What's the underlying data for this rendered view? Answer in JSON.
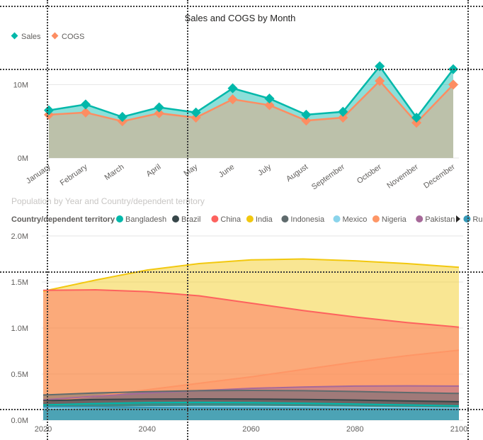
{
  "chart_data": [
    {
      "type": "area",
      "title": "Sales and COGS by Month",
      "legend_position": "top-left",
      "categories": [
        "January",
        "February",
        "March",
        "April",
        "May",
        "June",
        "July",
        "August",
        "September",
        "October",
        "November",
        "December"
      ],
      "y_tick_labels": [
        "0M",
        "10M"
      ],
      "ylim": [
        0,
        14000000
      ],
      "grid": true,
      "series": [
        {
          "name": "Sales",
          "color": "#01B8AA",
          "values": [
            6500000,
            7300000,
            5600000,
            6900000,
            6200000,
            9500000,
            8100000,
            5900000,
            6300000,
            12500000,
            5500000,
            12100000
          ]
        },
        {
          "name": "COGS",
          "color": "#FD8D62",
          "values": [
            5900000,
            6200000,
            5000000,
            6100000,
            5500000,
            8000000,
            7200000,
            5100000,
            5500000,
            10500000,
            4800000,
            10000000
          ]
        }
      ]
    },
    {
      "type": "area",
      "title": "Population by Year and Country/dependent territory",
      "legend_title": "Country/dependent territory",
      "legend_position": "top",
      "x": [
        2020,
        2030,
        2040,
        2050,
        2060,
        2070,
        2080,
        2090,
        2100
      ],
      "x_tick_labels": [
        "2020",
        "2040",
        "2060",
        "2080",
        "2100"
      ],
      "y_tick_labels": [
        "0.0M",
        "0.5M",
        "1.0M",
        "1.5M",
        "2.0M"
      ],
      "ylim": [
        0,
        2000000
      ],
      "grid": true,
      "series": [
        {
          "name": "Bangladesh",
          "color": "#01B8AA",
          "values": [
            165000,
            180000,
            190000,
            193000,
            190000,
            184000,
            175000,
            165000,
            155000
          ]
        },
        {
          "name": "Brazil",
          "color": "#374649",
          "values": [
            212000,
            224000,
            229000,
            231000,
            229000,
            225000,
            218000,
            209000,
            200000
          ]
        },
        {
          "name": "China",
          "color": "#FD625E",
          "values": [
            1410000,
            1415000,
            1395000,
            1350000,
            1270000,
            1190000,
            1120000,
            1060000,
            1010000
          ]
        },
        {
          "name": "India",
          "color": "#F2C80F",
          "values": [
            1400000,
            1520000,
            1630000,
            1700000,
            1740000,
            1750000,
            1730000,
            1700000,
            1660000
          ]
        },
        {
          "name": "Indonesia",
          "color": "#5F6B6D",
          "values": [
            273000,
            295000,
            310000,
            320000,
            323000,
            320000,
            312000,
            300000,
            290000
          ]
        },
        {
          "name": "Mexico",
          "color": "#8AD4EB",
          "values": [
            129000,
            138000,
            145000,
            148000,
            148000,
            145000,
            140000,
            135000,
            130000
          ]
        },
        {
          "name": "Nigeria",
          "color": "#FE9666",
          "values": [
            206000,
            260000,
            330000,
            400000,
            470000,
            550000,
            630000,
            700000,
            760000
          ]
        },
        {
          "name": "Pakistan",
          "color": "#A66999",
          "values": [
            220000,
            260000,
            295000,
            320000,
            345000,
            360000,
            370000,
            372000,
            370000
          ]
        },
        {
          "name": "Russia",
          "color": "#3599B8",
          "values": [
            145000,
            143000,
            138000,
            134000,
            130000,
            127000,
            124000,
            121000,
            118000
          ]
        }
      ]
    }
  ]
}
